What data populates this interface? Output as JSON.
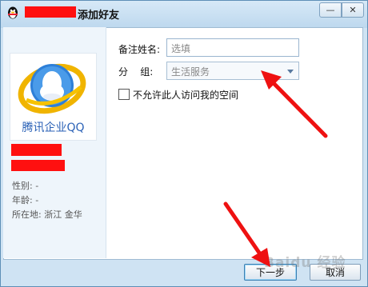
{
  "window": {
    "title": "添加好友",
    "minimize_label": "—",
    "close_label": "✕"
  },
  "profile": {
    "logo_caption": "腾讯企业QQ",
    "gender": "性别: -",
    "age": "年龄: -",
    "location": "所在地: 浙江  金华"
  },
  "form": {
    "remark_label": "备注姓名:",
    "remark_placeholder": "选填",
    "group_label": "分    组:",
    "group_value": "生活服务",
    "checkbox_label": "不允许此人访问我的空间",
    "checkbox_checked": false
  },
  "buttons": {
    "next_label": "下一步",
    "cancel_label": "取消"
  },
  "watermark": "Baidu 经验",
  "colors": {
    "redaction": "#ff1010",
    "annotation_arrow": "#ee1111"
  }
}
